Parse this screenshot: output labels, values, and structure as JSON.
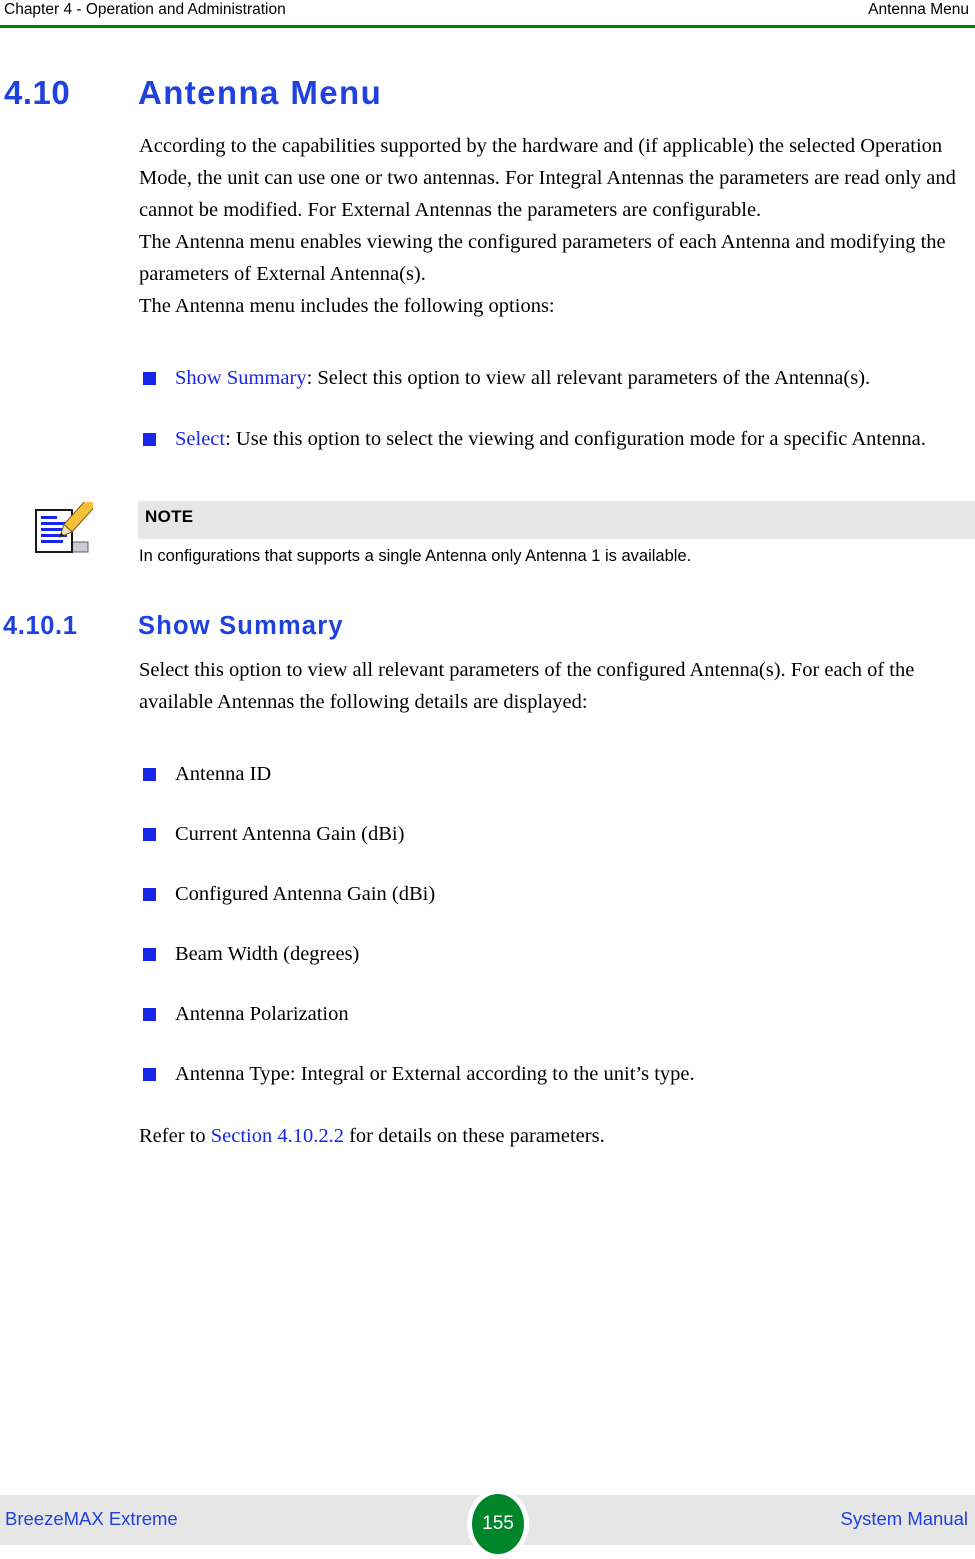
{
  "header": {
    "left": "Chapter 4 - Operation and Administration",
    "right": "Antenna Menu",
    "rule_color": "#008000"
  },
  "heading1": {
    "number": "4.10",
    "title": "Antenna Menu",
    "color": "#1f41e0"
  },
  "paragraphs": {
    "intro": "According to the capabilities supported by the hardware and (if applicable) the selected Operation Mode, the unit can use one or two antennas. For Integral Antennas the parameters are read only and cannot be modified. For External Antennas the parameters are configurable.",
    "enables": "The Antenna menu enables viewing the configured parameters of each Antenna and modifying the parameters of External Antenna(s).",
    "includes": "The Antenna menu includes the following options:",
    "show_summary_intro": "Select this option to view all relevant parameters of the configured Antenna(s). For each of the available Antennas the following details are displayed:"
  },
  "options_list": [
    {
      "link": "Show Summary",
      "rest": ": Select this option to view all relevant parameters of the Antenna(s)."
    },
    {
      "link": "Select",
      "rest": ": Use this option to select the viewing and configuration mode for a specific Antenna."
    }
  ],
  "note": {
    "icon": "notepad-pencil-icon",
    "title": "NOTE",
    "text": "In configurations that supports a single Antenna only Antenna 1 is available.",
    "bar_color": "#e6e6e6"
  },
  "heading2": {
    "number": "4.10.1",
    "title": "Show Summary",
    "color": "#1f41e0"
  },
  "details_list": [
    "Antenna ID",
    "Current Antenna Gain (dBi)",
    "Configured Antenna Gain (dBi)",
    "Beam Width (degrees)",
    "Antenna Polarization",
    "Antenna Type: Integral or External according to the unit’s type."
  ],
  "refer": {
    "prefix": "Refer to ",
    "link": "Section 4.10.2.2",
    "suffix": " for details on these parameters."
  },
  "footer": {
    "left": "BreezeMAX Extreme",
    "page_number": "155",
    "right": "System Manual",
    "band_color": "#e6e6e6",
    "badge_color": "#00862a"
  },
  "bullet_color": "#1726e8"
}
